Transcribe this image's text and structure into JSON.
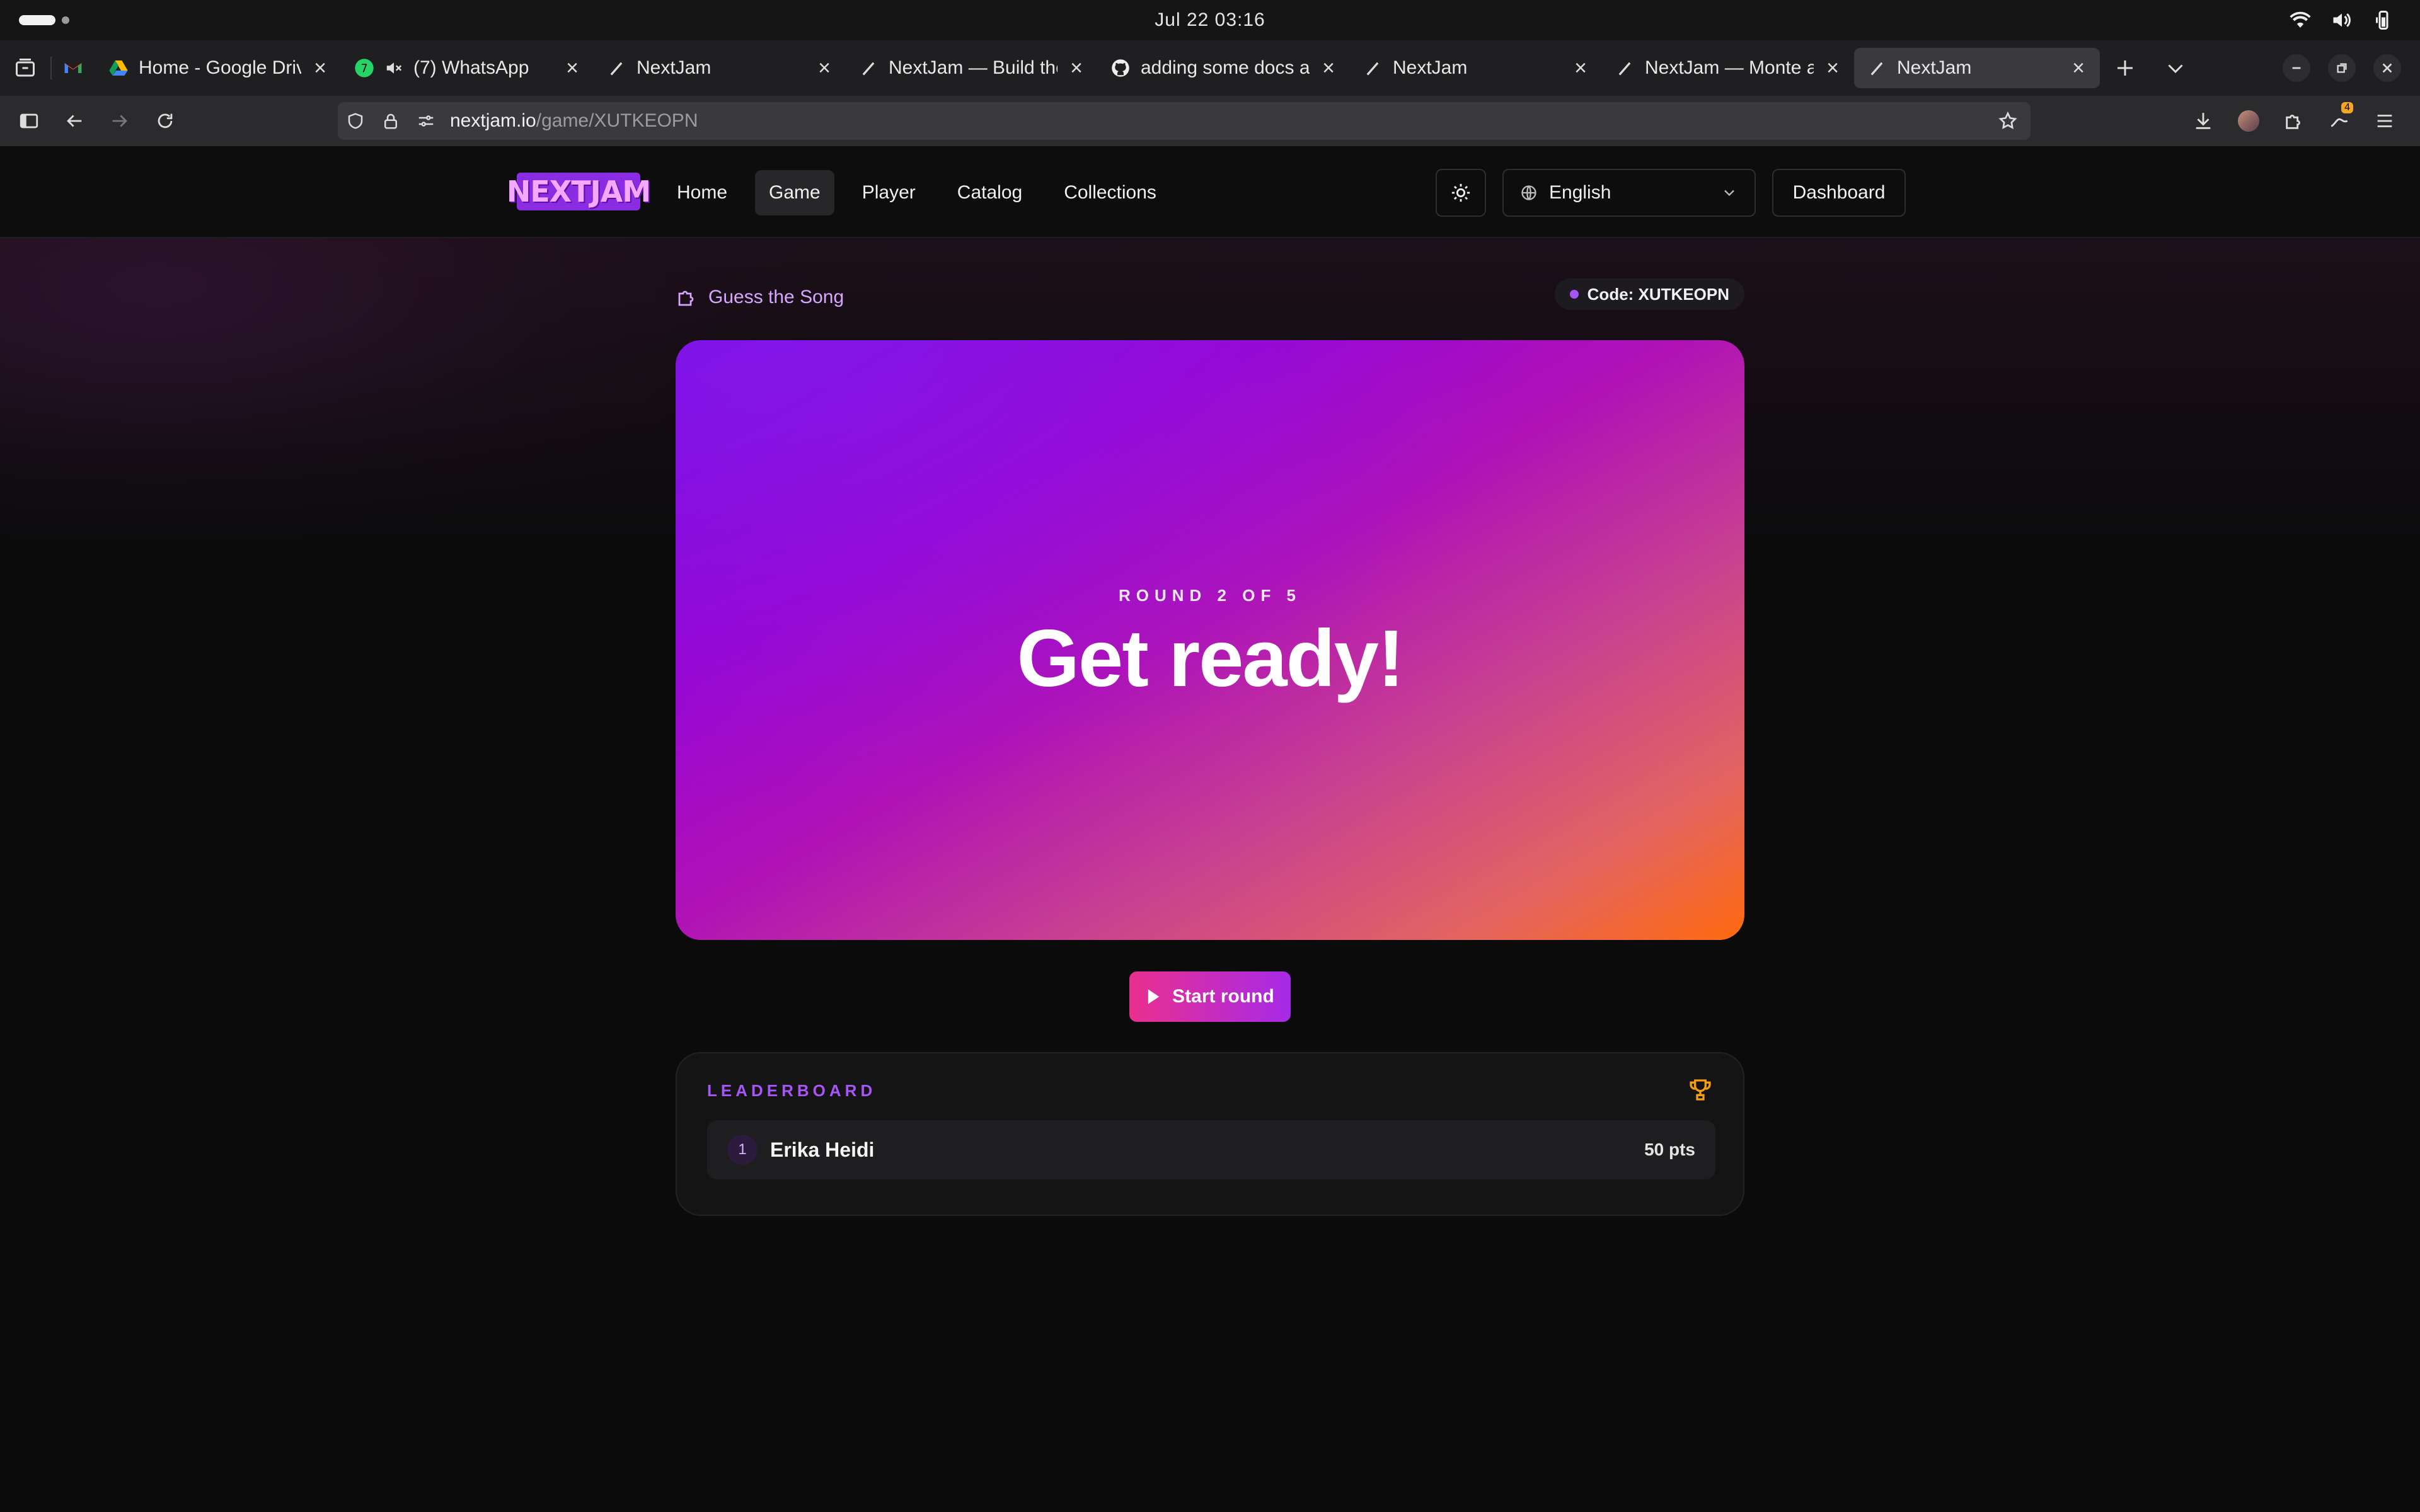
{
  "os": {
    "clock": "Jul 22  03:16"
  },
  "browser": {
    "tabs": [
      {
        "title": "",
        "favicon": "gmail-icon"
      },
      {
        "title": "Home - Google Drive",
        "favicon": "google-drive-icon"
      },
      {
        "title": "(7) WhatsApp",
        "favicon": "whatsapp-icon",
        "badge": "7",
        "muted": true
      },
      {
        "title": "NextJam",
        "favicon": "nextjam-icon"
      },
      {
        "title": "NextJam — Build the",
        "favicon": "nextjam-icon"
      },
      {
        "title": "adding some docs and",
        "favicon": "github-icon"
      },
      {
        "title": "NextJam",
        "favicon": "nextjam-icon"
      },
      {
        "title": "NextJam — Monte a p",
        "favicon": "nextjam-icon"
      },
      {
        "title": "NextJam",
        "favicon": "nextjam-icon",
        "active": true
      }
    ],
    "url_host": "nextjam.io",
    "url_path": "/game/XUTKEOPN",
    "extension_badge": "4"
  },
  "site": {
    "logo": "NEXTJAM",
    "nav": [
      {
        "label": "Home"
      },
      {
        "label": "Game",
        "active": true
      },
      {
        "label": "Player"
      },
      {
        "label": "Catalog"
      },
      {
        "label": "Collections"
      }
    ],
    "language": "English",
    "dashboard_label": "Dashboard"
  },
  "game": {
    "type_label": "Guess the Song",
    "code_label": "Code: XUTKEOPN",
    "round_label": "ROUND 2 OF 5",
    "title": "Get ready!",
    "start_label": "Start round"
  },
  "leaderboard": {
    "title": "LEADERBOARD",
    "rows": [
      {
        "rank": "1",
        "name": "Erika Heidi",
        "points": "50 pts"
      }
    ]
  },
  "colors": {
    "accent": "#a855f7",
    "start_gradient_from": "#ea2f8e",
    "start_gradient_to": "#a62ae8",
    "hero_from": "#7c0be0",
    "hero_to": "#ff6a10"
  }
}
